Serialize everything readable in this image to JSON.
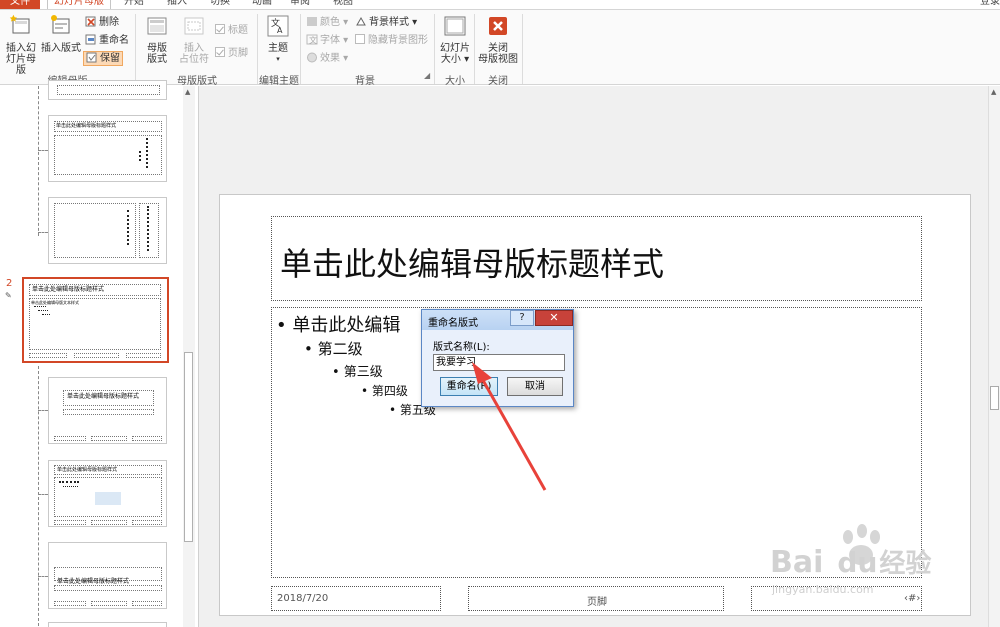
{
  "tabs": {
    "file": "文件",
    "items": [
      "幻灯片母版",
      "开始",
      "插入",
      "切换",
      "动画",
      "审阅",
      "视图"
    ],
    "account": "登录"
  },
  "ribbon": {
    "groups": {
      "edit_master": {
        "label": "编辑母版",
        "insert_slide_master_l1": "插入幻",
        "insert_slide_master_l2": "灯片母版",
        "insert_layout": "插入版式",
        "delete": "删除",
        "rename": "重命名",
        "preserve": "保留"
      },
      "master_layout": {
        "label": "母版版式",
        "master_layout_l1": "母版",
        "master_layout_l2": "版式",
        "insert_placeholder_l1": "插入",
        "insert_placeholder_l2": "占位符",
        "title_chk": "标题",
        "footer_chk": "页脚"
      },
      "edit_theme": {
        "label": "编辑主题",
        "themes": "主题"
      },
      "background": {
        "label": "背景",
        "colors": "颜色",
        "fonts": "字体",
        "effects": "效果",
        "bg_styles": "背景样式",
        "hide_bg": "隐藏背景图形"
      },
      "size": {
        "label": "大小",
        "slide_size_l1": "幻灯片",
        "slide_size_l2": "大小"
      },
      "close": {
        "label": "关闭",
        "close_l1": "关闭",
        "close_l2": "母版视图"
      }
    }
  },
  "thumbnails": {
    "selected_number": "2",
    "title_text": "单击此处编辑母版标题样式",
    "body_text": "单击此处编辑母版文本样式"
  },
  "slide": {
    "title": "单击此处编辑母版标题样式",
    "level1": "• 单击此处编辑",
    "level2": "• 第二级",
    "level3": "• 第三级",
    "level4": "• 第四级",
    "level5": "• 第五级",
    "date": "2018/7/20",
    "footer": "页脚",
    "page_num": "‹#›"
  },
  "dialog": {
    "title": "重命名版式",
    "help": "?",
    "close": "✕",
    "label": "版式名称(L):",
    "value": "我要学习",
    "ok": "重命名(R)",
    "cancel": "取消"
  },
  "watermark": {
    "brand": "Bai",
    "brand2": "du",
    "cn": "经验",
    "url": "jingyan.baidu.com"
  },
  "colors": {
    "accent": "#d24726",
    "annotation": "#e8423a"
  }
}
